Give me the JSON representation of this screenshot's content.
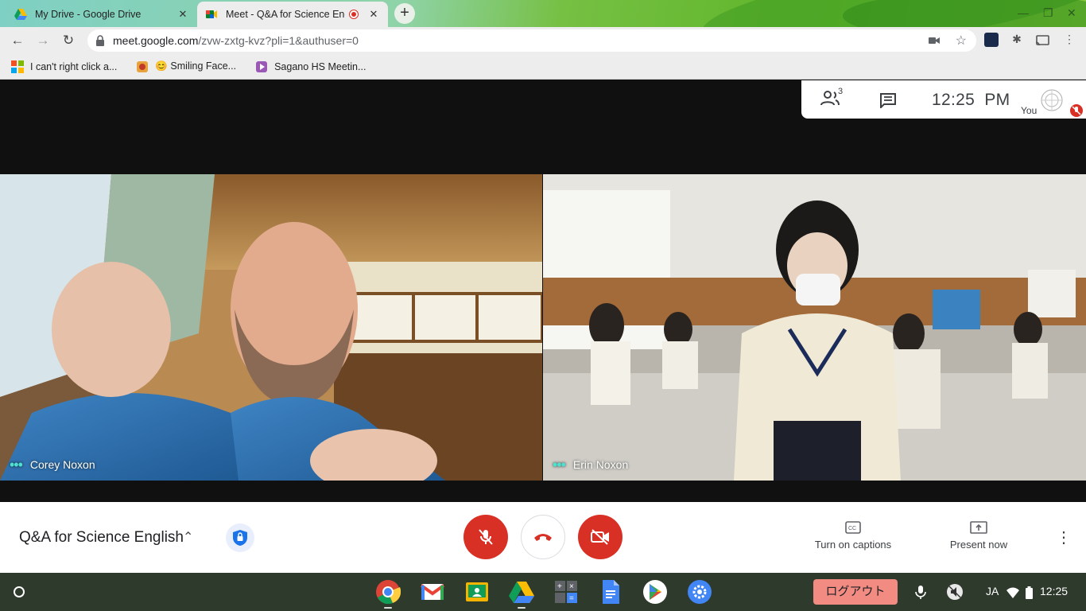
{
  "browser": {
    "tabs": [
      {
        "title": "My Drive - Google Drive",
        "close": "✕"
      },
      {
        "title": "Meet - Q&A for Science English",
        "close": "✕"
      }
    ],
    "new_tab": "+",
    "url": {
      "host": "meet.google.com",
      "path": "/zvw-zxtg-kvz?pli=1&authuser=0"
    },
    "bookmarks": [
      {
        "label": "I can't right click a..."
      },
      {
        "label": "😊 Smiling Face..."
      },
      {
        "label": "Sagano HS Meetin..."
      }
    ]
  },
  "meet": {
    "participants_count": "3",
    "clock": "12:25  PM",
    "self_label": "You",
    "tiles": [
      {
        "name": "Corey Noxon"
      },
      {
        "name": "Erin Noxon"
      }
    ],
    "meeting_title": "Q&A for Science English",
    "actions": {
      "captions": "Turn on captions",
      "present": "Present now"
    }
  },
  "shelf": {
    "logout": "ログアウト",
    "ime": "JA",
    "time": "12:25"
  },
  "colors": {
    "danger": "#d93025",
    "logout_bg": "#f28b82",
    "shelf_bg": "#2e3a2c"
  }
}
